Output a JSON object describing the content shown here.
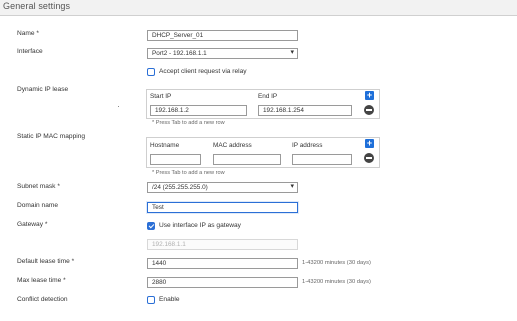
{
  "section": {
    "title": "General settings"
  },
  "fields": {
    "name": {
      "label": "Name *",
      "value": "DHCP_Server_01"
    },
    "interface": {
      "label": "Interface",
      "value": "Port2 - 192.168.1.1"
    },
    "accept_relay": {
      "label": "Accept client request via relay",
      "checked": false
    },
    "dynamic_ip": {
      "label": "Dynamic IP lease",
      "col_start": "Start IP",
      "col_end": "End IP",
      "start_ip": "192.168.1.2",
      "end_ip": "192.168.1.254",
      "hint": "* Press Tab to add a new row"
    },
    "static_mac": {
      "label": "Static IP MAC mapping",
      "col_hostname": "Hostname",
      "col_mac": "MAC address",
      "col_ip": "IP address",
      "hostname": "",
      "mac": "",
      "ip": "",
      "hint": "* Press Tab to add a new row"
    },
    "subnet_mask": {
      "label": "Subnet mask *",
      "value": "/24 (255.255.255.0)"
    },
    "domain_name": {
      "label": "Domain name",
      "value": "Test"
    },
    "gateway": {
      "label": "Gateway *",
      "use_interface_label": "Use interface IP as gateway",
      "use_interface_checked": true,
      "value": "192.168.1.1"
    },
    "default_lease": {
      "label": "Default lease time *",
      "value": "1440",
      "unit": "1-43200 minutes (30 days)"
    },
    "max_lease": {
      "label": "Max lease time *",
      "value": "2880",
      "unit": "1-43200 minutes (30 days)"
    },
    "conflict": {
      "label": "Conflict detection",
      "enable_label": "Enable",
      "checked": false
    }
  },
  "colors": {
    "accent": "#2b6fd6",
    "add_button": "#1e6fd9",
    "remove_button": "#444444"
  }
}
